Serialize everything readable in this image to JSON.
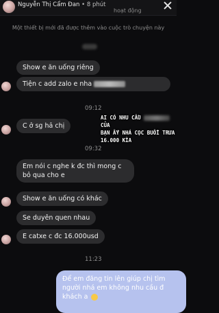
{
  "header": {
    "name": "Nguyễn Thị Cẩm Đan",
    "time": "8 phút",
    "status": "hoạt động"
  },
  "notice": "Một thiết bị mới đã được thêm vào cuộc trò chuyện này",
  "messages": [
    {
      "text": "Show e ăn uống riêng"
    },
    {
      "text": "Tiện c add zalo e nha"
    },
    {
      "text": "C ở sg hả chị"
    },
    {
      "text": "Em nói c nghe k đc thì mong c bỏ qua cho e"
    },
    {
      "text": "Show e ăn uống có khác"
    },
    {
      "text": "Se duyên quen nhau"
    },
    {
      "text": "E catxe c đc 16.000usd"
    }
  ],
  "timestamps": [
    "09:12",
    "09:32",
    "11:23"
  ],
  "overlay": {
    "line1_a": "AI CÓ NHU CẦU",
    "line1_b": "CỦA",
    "line2": "BẠN ẤY NHÁ CỌC BUỔI TRƯA",
    "line3": "16.000 KÌA"
  },
  "outgoing": {
    "text": "Để em đăng tin lên giúp chị tìm người nhá em không nhu cầu đ khách a"
  }
}
